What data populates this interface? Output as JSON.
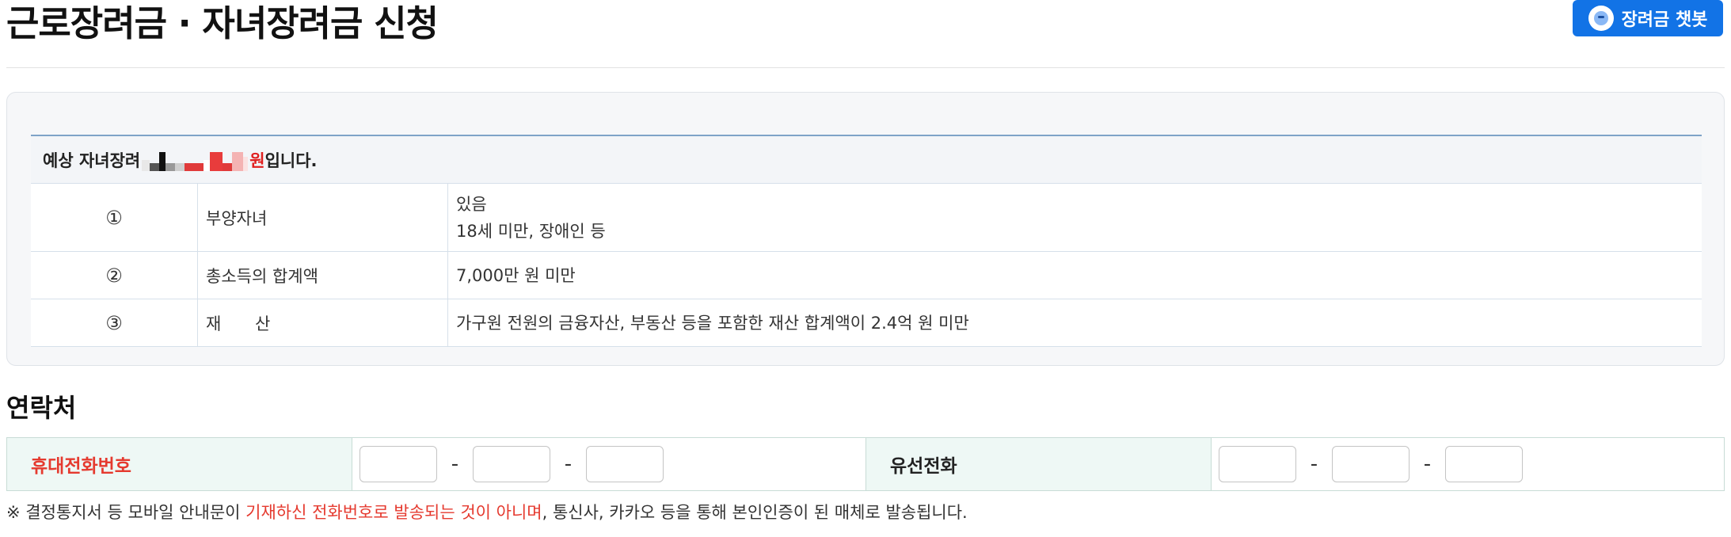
{
  "header": {
    "title": "근로장려금 · 자녀장려금 신청",
    "chatbot_label": "장려금 챗봇"
  },
  "estimate": {
    "prefix": "예상 자녀장려",
    "won": "원",
    "suffix": "입니다.",
    "rows": [
      {
        "num": "①",
        "label": "부양자녀",
        "value_lines": [
          "있음",
          "18세 미만, 장애인 등"
        ]
      },
      {
        "num": "②",
        "label": "총소득의 합계액",
        "value_lines": [
          "7,000만 원 미만"
        ]
      },
      {
        "num": "③",
        "label": "재 산",
        "value_lines": [
          "가구원 전원의 금융자산, 부동산 등을 포함한 재산 합계액이 2.4억 원 미만"
        ]
      }
    ]
  },
  "contact": {
    "title": "연락처",
    "mobile_label": "휴대전화번호",
    "landline_label": "유선전화",
    "dash": "-",
    "mobile": [
      "",
      "",
      ""
    ],
    "landline": [
      "",
      "",
      ""
    ]
  },
  "notice": {
    "part1": "※ 결정통지서 등 모바일 안내문이 ",
    "highlight": "기재하신 전화번호로 발송되는 것이 아니며",
    "part2": ", 통신사, 카카오 등을 통해 본인인증이 된 매체로 발송됩니다."
  },
  "colors": {
    "accent_blue": "#1273e6",
    "highlight_red": "#e53a2f",
    "label_bg": "#eef8f5"
  }
}
